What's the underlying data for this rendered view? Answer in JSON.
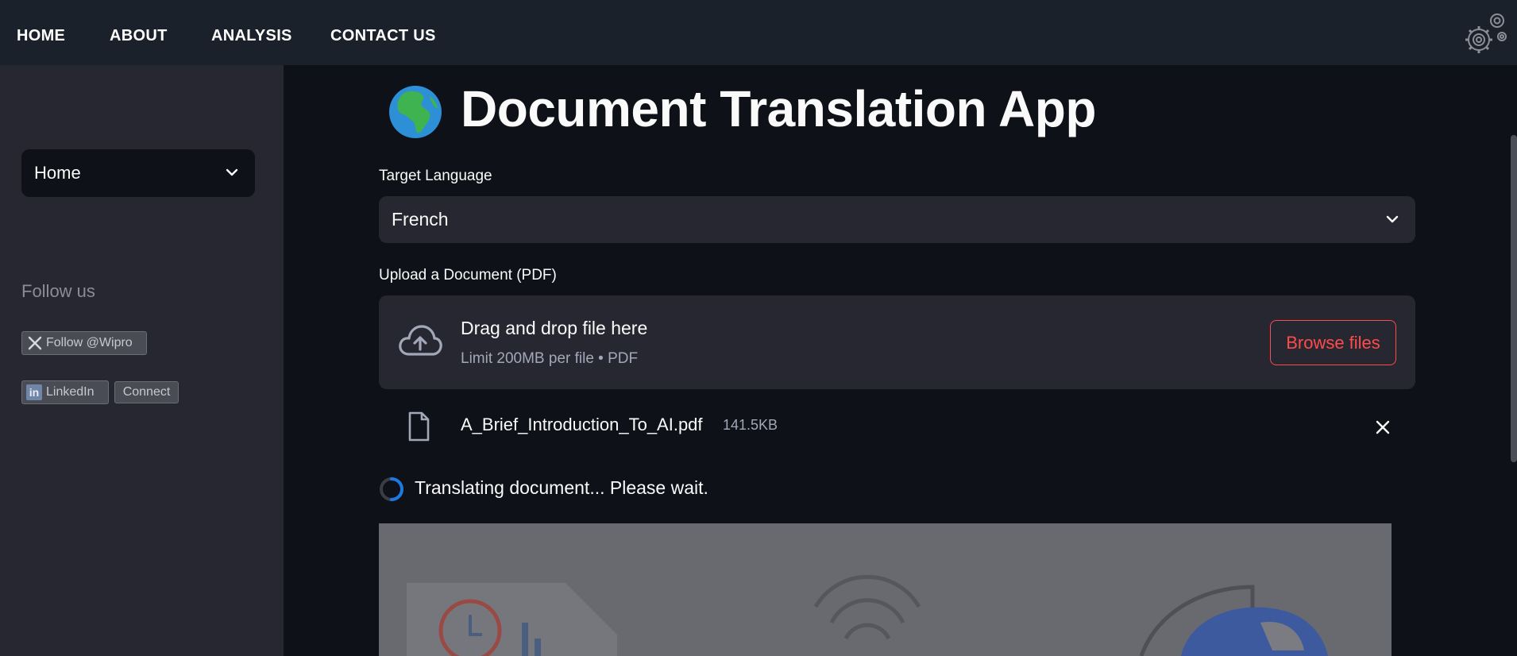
{
  "topnav": {
    "items": [
      {
        "label": "HOME"
      },
      {
        "label": "ABOUT"
      },
      {
        "label": "ANALYSIS"
      },
      {
        "label": "CONTACT US"
      }
    ],
    "settings_icon": "gears-icon"
  },
  "sidebar": {
    "page_select": {
      "value": "Home",
      "icon": "chevron-down-icon"
    },
    "follow_heading": "Follow us",
    "twitter_button": {
      "label": "Follow @Wipro",
      "icon": "x-logo-icon"
    },
    "linkedin_button": {
      "label": "LinkedIn",
      "icon_text": "in",
      "connect_label": "Connect"
    }
  },
  "main": {
    "title_icon": "globe-africa-icon",
    "title": "Document Translation App",
    "target_language": {
      "label": "Target Language",
      "value": "French"
    },
    "upload": {
      "label": "Upload a Document (PDF)",
      "drop_text": "Drag and drop file here",
      "limit_text": "Limit 200MB per file • PDF",
      "browse_label": "Browse files"
    },
    "uploaded_file": {
      "name": "A_Brief_Introduction_To_AI.pdf",
      "size": "141.5KB"
    },
    "status": "Translating document... Please wait."
  },
  "colors": {
    "nav_bg": "#1a212b",
    "sidebar_bg": "#262730",
    "main_bg": "#0e1117",
    "accent": "#ff4b4b",
    "spinner": "#1f77e0"
  }
}
